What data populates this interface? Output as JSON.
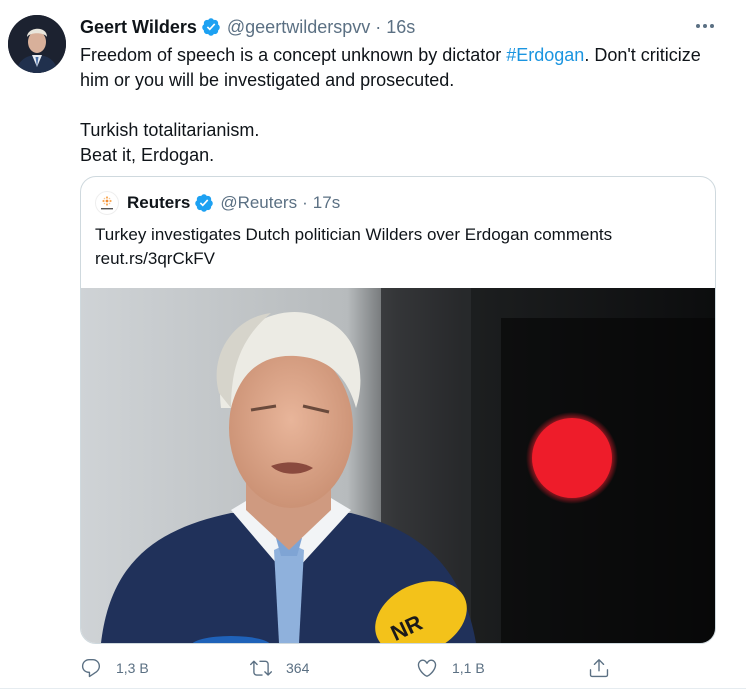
{
  "tweet": {
    "author_name": "Geert Wilders",
    "author_handle": "@geertwilderspvv",
    "separator": "·",
    "time": "16s",
    "text_line1_pre": "Freedom of speech is a concept unknown by dictator ",
    "hashtag": "#Erdogan",
    "text_line1_post": ". Don't criticize him or you will be investigated and prosecuted.",
    "text_line2": "Turkish totalitarianism.",
    "text_line3": "Beat it, Erdogan."
  },
  "quote": {
    "author_name": "Reuters",
    "author_handle": "@Reuters",
    "separator": "·",
    "time": "17s",
    "headline": "Turkey investigates Dutch politician Wilders over Erdogan comments",
    "link": "reut.rs/3qrCkFV",
    "mic_label": "NR"
  },
  "actions": {
    "reply_count": "1,3 В",
    "retweet_count": "364",
    "like_count": "1,1 В"
  },
  "colors": {
    "accent": "#1da1f2",
    "hashtag": "#1b95e0",
    "muted": "#5b7083",
    "text": "#0f1419"
  },
  "icons": [
    "verified-badge-icon",
    "more-icon",
    "reply-icon",
    "retweet-icon",
    "like-icon",
    "share-icon"
  ]
}
